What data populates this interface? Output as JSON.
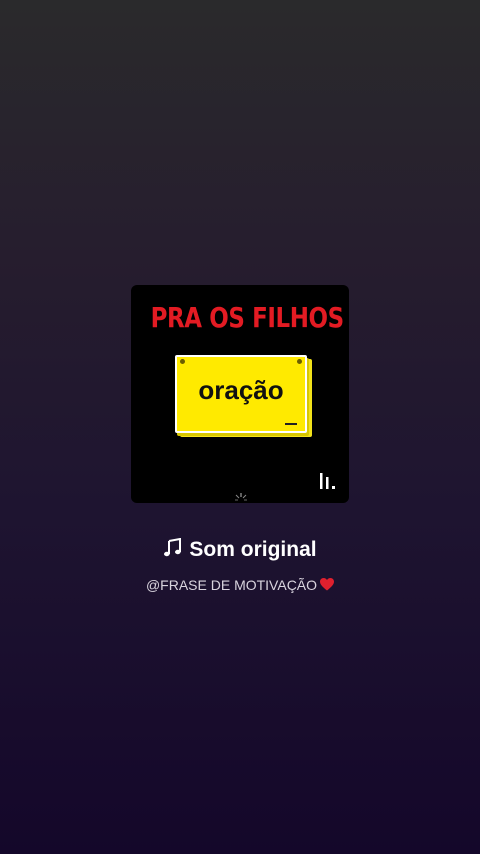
{
  "cover": {
    "headline": "PRA OS FILHOS",
    "note_text": "oração",
    "brand_icon": "bars-logo-icon"
  },
  "sound": {
    "icon": "music-note-icon",
    "title": "Som original",
    "author": "@FRASE DE MOTIVAÇÃO",
    "author_icon": "heart-icon"
  },
  "colors": {
    "headline_red": "#e31b23",
    "note_yellow": "#ffea00",
    "heart_red": "#e0202e"
  }
}
